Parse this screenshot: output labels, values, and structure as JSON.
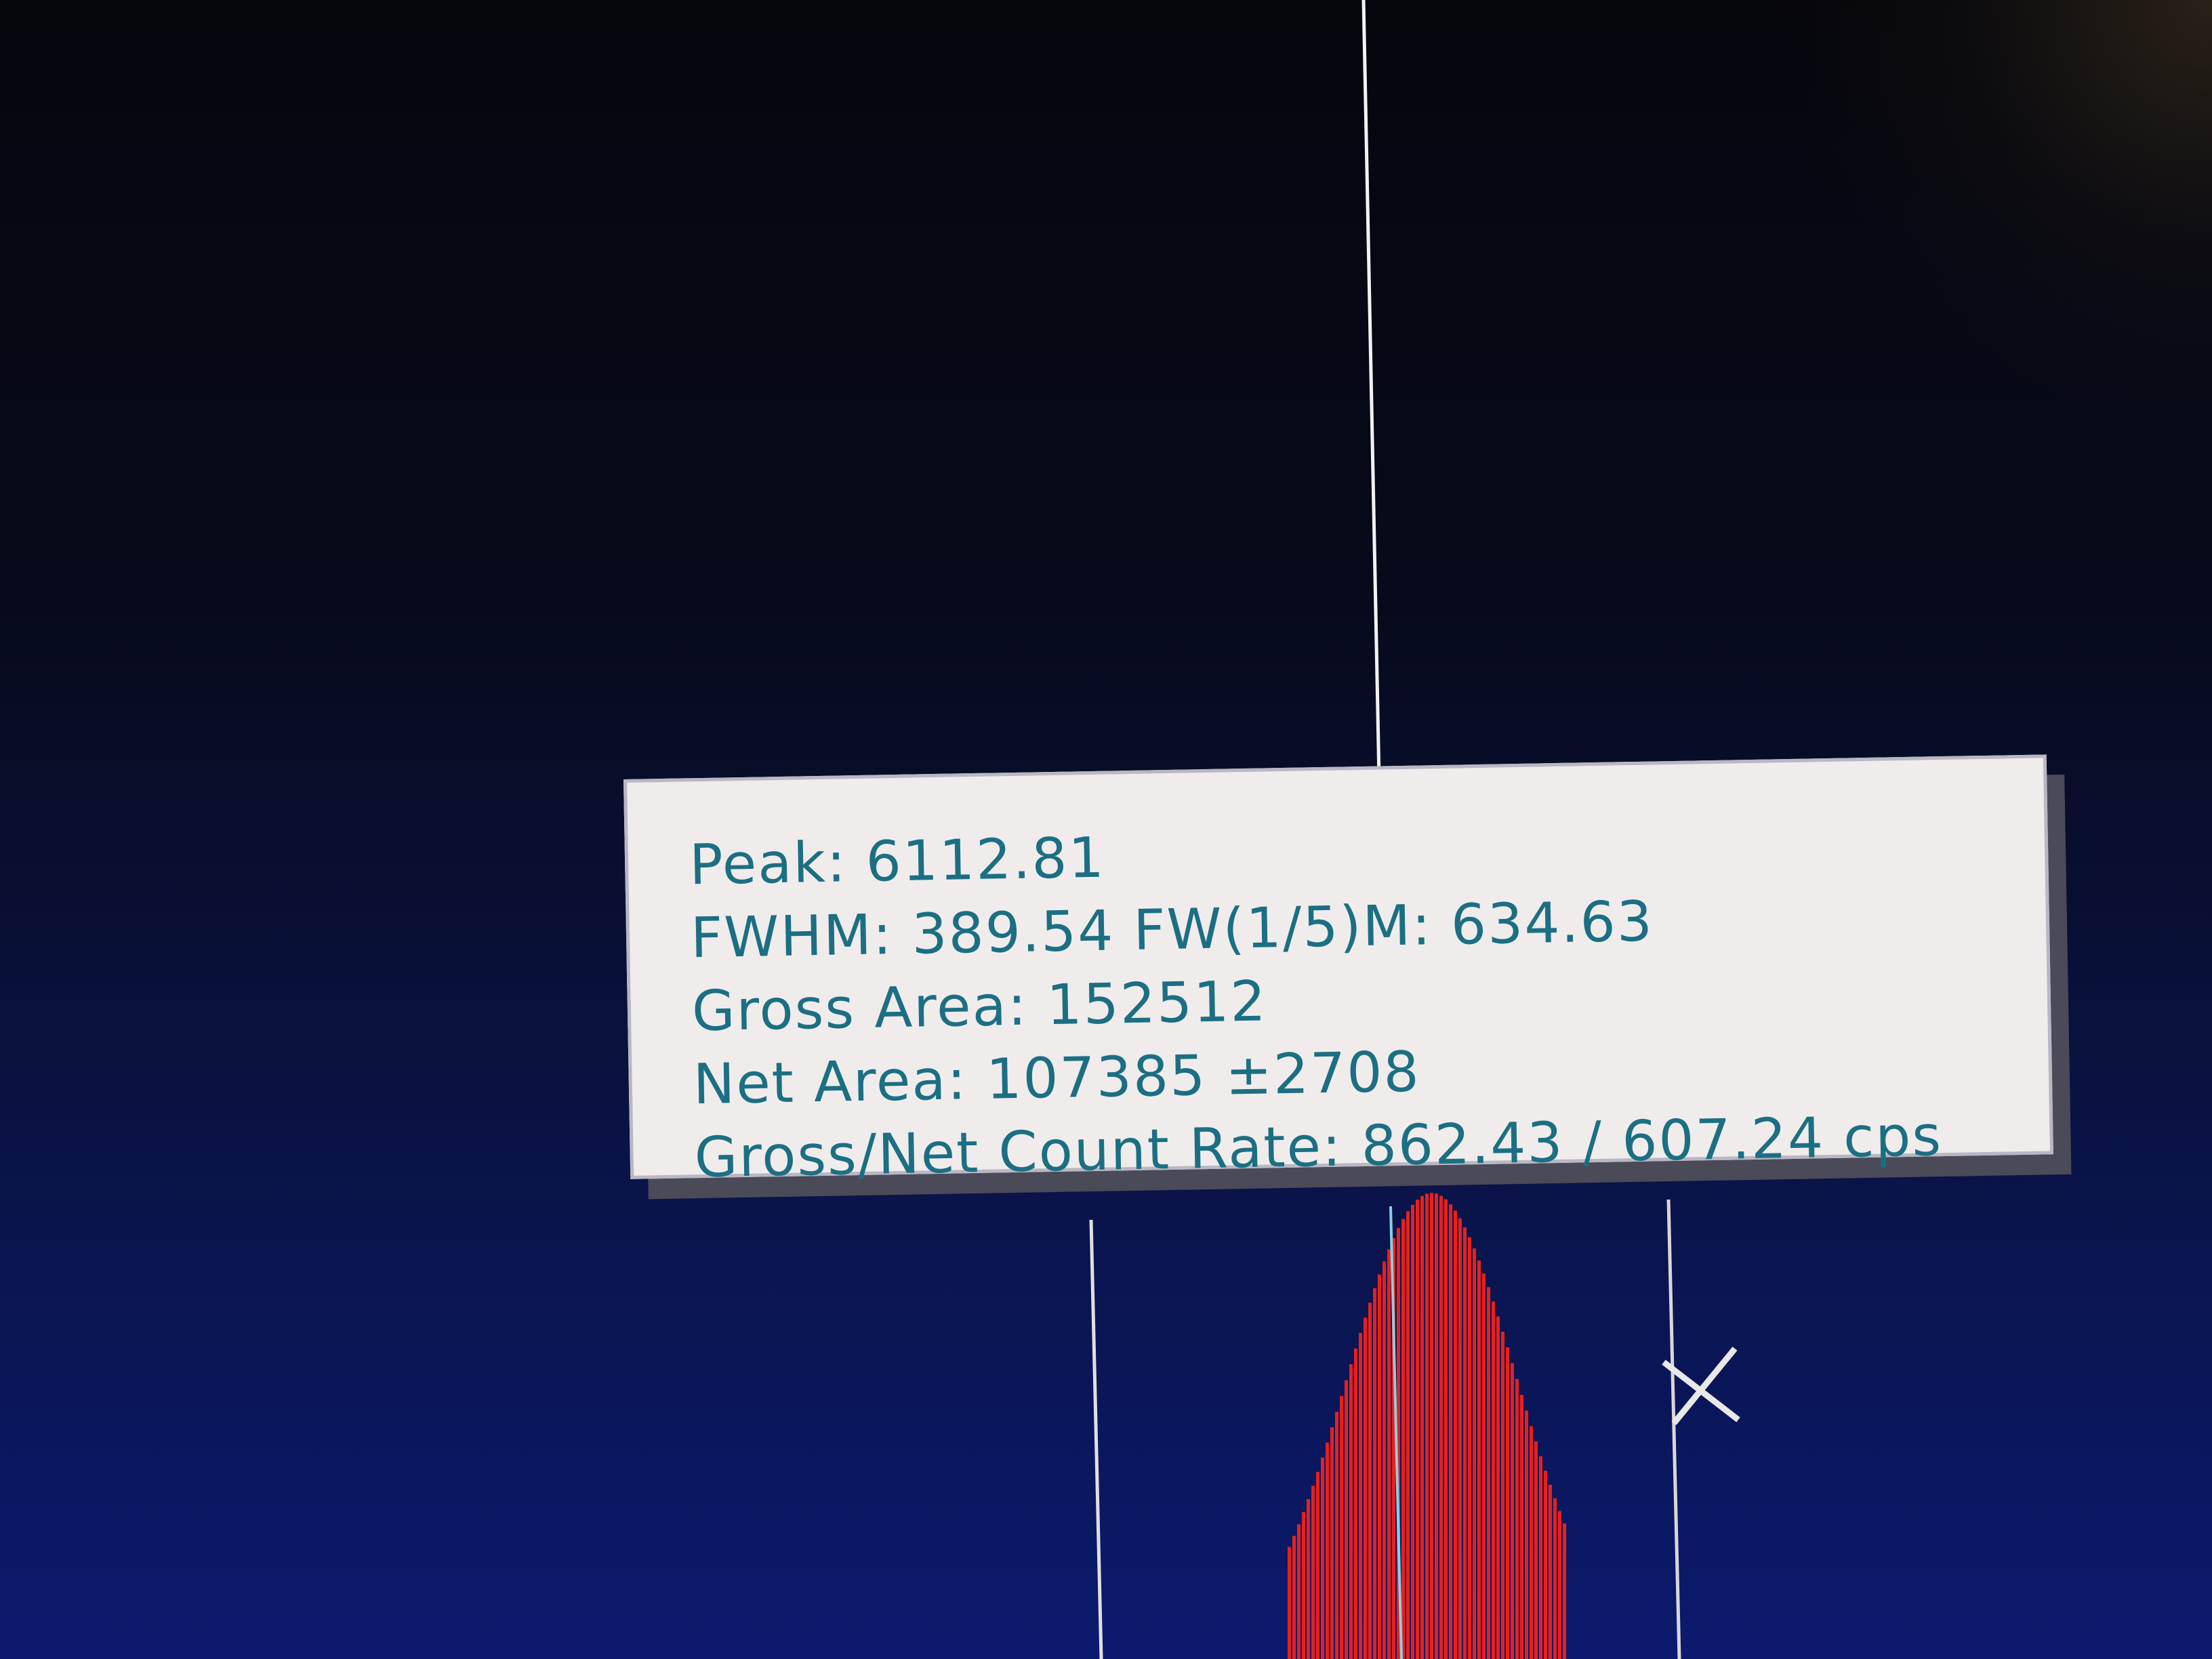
{
  "peak_info": {
    "peak": "Peak: 6112.81",
    "fwhm": "FWHM: 389.54  FW(1/5)M: 634.63",
    "gross_area": "Gross Area: 152512",
    "net_area": "Net Area: 107385 ±2708",
    "count_rate": "Gross/Net Count Rate: 862.43 / 607.24 cps"
  },
  "colors": {
    "peak_fill": "#e8201c",
    "cursor_line": "#ffffff",
    "tooltip_text": "#1c6f83",
    "tooltip_bg": "#f0ecec"
  },
  "icons": {
    "marker": "x-marker-icon"
  }
}
